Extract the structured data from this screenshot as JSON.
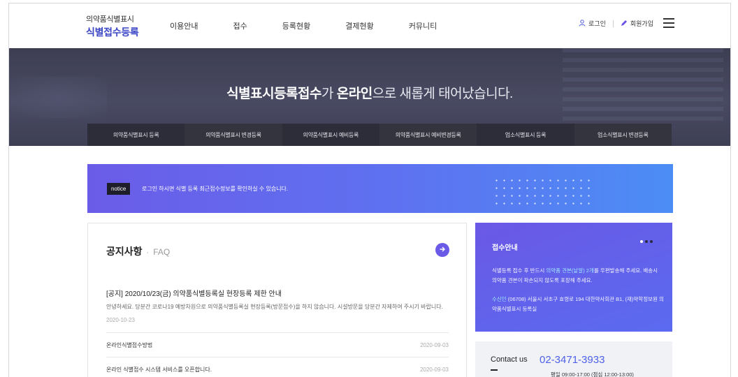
{
  "header": {
    "logo_line1": "의약품식별표시",
    "logo_line2": "식별접수등록",
    "nav": [
      "이용안내",
      "접수",
      "등록현황",
      "결제현황",
      "커뮤니티"
    ],
    "login": "로그인",
    "signup": "회원가입"
  },
  "hero": {
    "title_bold1": "식별표시등록접수",
    "title_mid": "가 ",
    "title_bold2": "온라인",
    "title_tail": "으로 새롭게 태어났습니다.",
    "quick_links": [
      "의약품식별표시 등록",
      "의약품식별표시 변경등록",
      "의약품식별표시 예비등록",
      "의약품식별표시 예비변경등록",
      "업소식별표시 등록",
      "업소식별표시 변경등록"
    ]
  },
  "notice_banner": {
    "tag": "notice",
    "text": "로그인 하시면 식별 등록 최근접수정보를 확인하실 수 있습니다."
  },
  "board": {
    "tab_active": "공지사항",
    "separator": "·",
    "tab_other": "FAQ",
    "featured": {
      "title": "[공지] 2020/10/23(금) 의약품식별등록실 현장등록 제한 안내",
      "body": "안녕하세요. 당분간 코로나19 예방차원으로 의약품식별등록실 현장등록(방문접수)을 하지 않습니다. 시설방문을 당분간 자제하여 주시기 바랍니다.",
      "date": "2020-10-23"
    },
    "rows": [
      {
        "title": "온라인식별접수방법",
        "date": "2020-09-03"
      },
      {
        "title": "온라인 식별접수 시스템 서비스를 오픈합니다.",
        "date": "2020-09-03"
      }
    ]
  },
  "side": {
    "title": "접수안내",
    "p1_a": "식별등록 접수 후 반드시 ",
    "p1_hl": "의약품 견본(낱알) 2개",
    "p1_b": "를 우편발송해 주세요. 배송시 의약품 견본이 파손되지 않도록 포장해 주세요.",
    "p2_hl": "수신인",
    "p2_a": " (06708) 서울시 서초구 효령로 194 대한약사회관 B1, (재)약학정보원 의약품식별표시 등록실"
  },
  "contact": {
    "label": "Contact us",
    "phone": "02-3471-3933",
    "hours": "평일 09:00-17:00 (점심 12:00-13:00)"
  },
  "colors": {
    "brand": "#3b46c4",
    "accent": "#6a5ae8",
    "hero_bg": "#44455c",
    "phone": "#4e60e8"
  }
}
